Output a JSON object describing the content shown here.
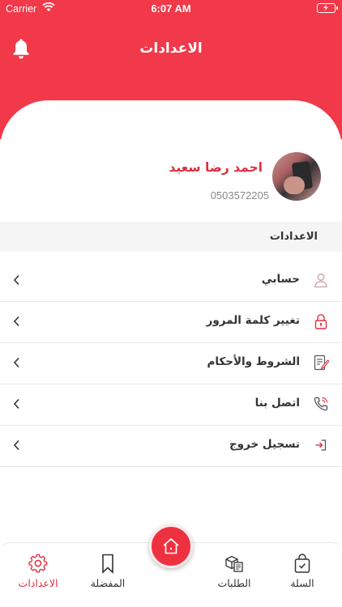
{
  "status_bar": {
    "carrier": "Carrier",
    "time": "6:07 AM"
  },
  "header": {
    "title": "الاعدادات"
  },
  "profile": {
    "name": "احمد رضا سعيد",
    "phone": "0503572205"
  },
  "section": {
    "title": "الاعدادات"
  },
  "menu": {
    "items": [
      {
        "label": "حسابي",
        "icon": "user-icon"
      },
      {
        "label": "تغيير كلمة المرور",
        "icon": "lock-icon"
      },
      {
        "label": "الشروط والأحكام",
        "icon": "document-edit-icon"
      },
      {
        "label": "اتصل بنا",
        "icon": "phone-call-icon"
      },
      {
        "label": "تسجيل خروج",
        "icon": "logout-icon"
      }
    ]
  },
  "tabs": {
    "settings": "الاعدادات",
    "favorites": "المفضلة",
    "orders": "الطلبات",
    "cart": "السلة"
  },
  "colors": {
    "primary": "#f1394a",
    "accent_text": "#e02f3f"
  }
}
